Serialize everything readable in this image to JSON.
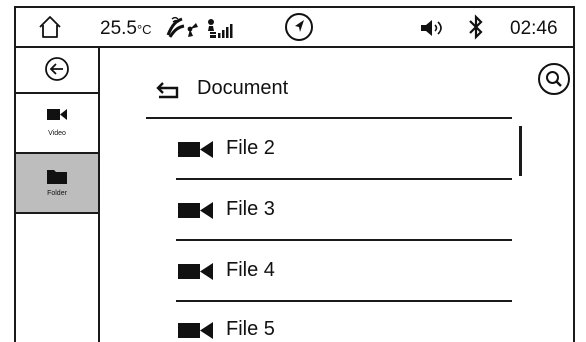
{
  "status": {
    "home_icon": "home-icon",
    "temperature": "25.5",
    "temperature_unit": "°C",
    "fan_icon": "defrost-fan-icon",
    "signal_icon": "signal-strength-icon",
    "navigation_icon": "navigation-arrow-icon",
    "volume_icon": "volume-icon",
    "bluetooth_icon": "bluetooth-icon",
    "time": "02:46"
  },
  "sidebar": {
    "back_icon": "back-circle-icon",
    "items": [
      {
        "label": "Video",
        "icon": "video-camera-icon",
        "selected": false
      },
      {
        "label": "Folder",
        "icon": "folder-icon",
        "selected": true
      }
    ]
  },
  "browser": {
    "back_icon": "return-arrow-icon",
    "title": "Document",
    "search_icon": "search-icon",
    "files": [
      {
        "name": "File 2",
        "icon": "video-file-icon"
      },
      {
        "name": "File 3",
        "icon": "video-file-icon"
      },
      {
        "name": "File 4",
        "icon": "video-file-icon"
      },
      {
        "name": "File 5",
        "icon": "video-file-icon"
      }
    ]
  },
  "colors": {
    "line": "#1a1a1a",
    "selected_bg": "#bdbdbd",
    "background": "#ffffff"
  }
}
